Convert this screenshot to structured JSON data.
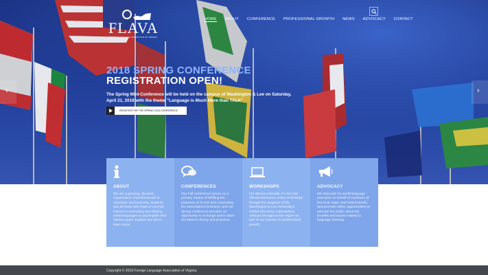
{
  "brand": {
    "logo_text": "FLAVA",
    "logo_tagline": "FOREIGN LANGUAGE ASSOCIATION OF VIRGINIA"
  },
  "nav": {
    "items": [
      "HOME",
      "ABOUT",
      "CONFERENCE",
      "PROFESSIONAL GROWTH",
      "NEWS",
      "ADVOCACY",
      "CONTACT"
    ],
    "active": "HOME"
  },
  "hero": {
    "headline_1": "2018 SPRING CONFERENCE",
    "headline_2": "REGISTRATION OPEN!",
    "intro": "The Spring Mini-Conference will be held on the campus of Washington & Lee on Saturday, April 21, 2018 with the theme \"Language is Much More than TALK\"",
    "cta_label": "REGISTER FOR THE SPRING 2018 CONFERENCE"
  },
  "cards": [
    {
      "title": "ABOUT",
      "icon": "info-icon",
      "bg": "#8db2f0",
      "body": "We are a growing, dynamic organization of professionals in education and business, students, and all those who have a common interest in promoting and utilizing world languages to accomplish their various goals. Explore our site to learn more!"
    },
    {
      "title": "CONFERENCES",
      "icon": "chat-bubbles-icon",
      "bg": "#7fa6ea",
      "body": "Our Fall conference serves as a primary means of fulfilling the purposes of FLAVA and conducting the association's business, and our Spring conference provides an opportunity to recharge and to learn the latest in theory and practices."
    },
    {
      "title": "WORKSHOPS",
      "icon": "laptop-icon",
      "bg": "#8db2f0",
      "body": "For almost a decade, FLAVA has offered interactive online workshops through the auspices of the Washington & Lee University's Global Discovery Laboratories, webcast throughout the region as part of our mission for professional growth."
    },
    {
      "title": "ADVOCACY",
      "icon": "megaphone-icon",
      "bg": "#7fa6ea",
      "body": "We advocate for world language education on behalf of members at the local, state, and federal levels, and promote online opportunities to educate the public about the benefits and issues related to language learning."
    }
  ],
  "footer": {
    "copyright": "Copyright © 2018 Foreign Language Association of Virginia."
  },
  "colors": {
    "headline_accent": "#8fb2ff",
    "footer_bg": "#45484c",
    "hero_bg": "#1f3a93"
  }
}
